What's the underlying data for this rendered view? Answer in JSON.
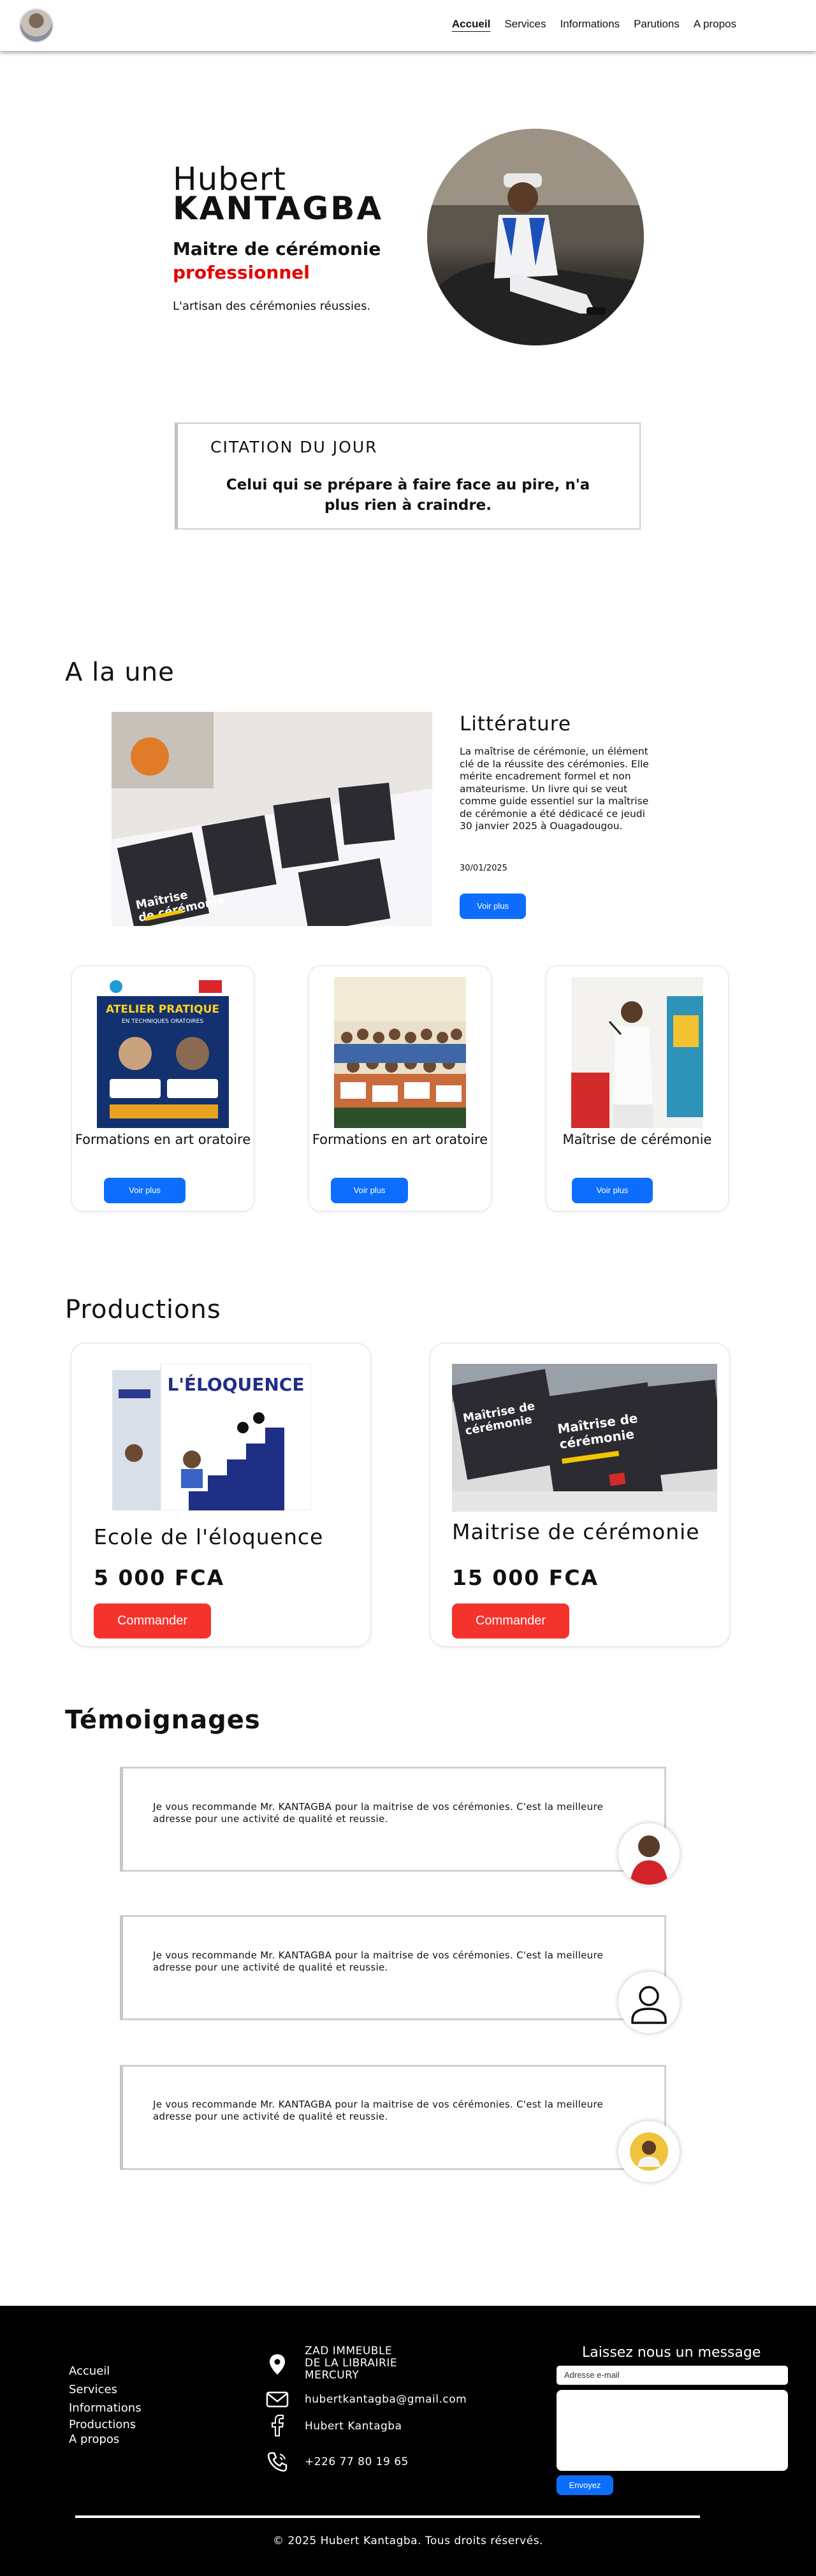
{
  "nav": {
    "items": [
      "Accueil",
      "Services",
      "Informations",
      "Parutions",
      "A propos"
    ]
  },
  "hero": {
    "name_first": "Hubert",
    "name_last": "KANTAGBA",
    "role_line1": "Maitre de cérémonie",
    "role_line2": "professionnel",
    "tagline": "L'artisan des cérémonies réussies."
  },
  "quote": {
    "title": "CITATION DU JOUR",
    "text": "Celui qui se prépare à faire face au pire, n'a plus rien à craindre."
  },
  "featured": {
    "heading": "A la une",
    "title": "Littérature",
    "body": "La maîtrise de cérémonie, un élément clé de la réussite des cérémonies. Elle mérite encadrement formel et non amateurisme. Un livre qui se veut comme guide essentiel sur la maîtrise de cérémonie a été dédicacé ce jeudi 30 janvier 2025 à Ouagadougou.",
    "date": "30/01/2025",
    "button": "Voir plus",
    "cards": [
      {
        "title": "Formations en art oratoire",
        "button": "Voir plus",
        "poster_title": "ATELIER PRATIQUE",
        "poster_sub": "EN TECHNIQUES ORATOIRES"
      },
      {
        "title": "Formations en art oratoire",
        "button": "Voir plus"
      },
      {
        "title": "Maîtrise de cérémonie",
        "button": "Voir plus"
      }
    ]
  },
  "productions": {
    "heading": "Productions",
    "items": [
      {
        "title": "Ecole de l'éloquence",
        "price": "5 000 FCA",
        "button": "Commander",
        "cover_text": "L'ÉLOQUENCE"
      },
      {
        "title": "Maitrise de cérémonie",
        "price": "15 000 FCA",
        "button": "Commander",
        "cover_text": "Maîtrise de cérémonie"
      }
    ]
  },
  "testimonials": {
    "heading": "Témoignages",
    "items": [
      {
        "text": "Je vous recommande Mr. KANTAGBA pour la maitrise de vos cérémonies. C'est la meilleure adresse pour une activité de qualité et reussie."
      },
      {
        "text": "Je vous recommande Mr. KANTAGBA pour la maitrise de vos cérémonies. C'est la meilleure adresse pour une activité de qualité et reussie."
      },
      {
        "text": "Je vous recommande Mr. KANTAGBA pour la maitrise de vos cérémonies. C'est la meilleure adresse pour une activité de qualité et reussie."
      }
    ]
  },
  "footer": {
    "links": [
      "Accueil",
      "Services",
      "Informations",
      "Productions",
      "A propos"
    ],
    "address": "ZAD IMMEUBLE DE LA LIBRAIRIE MERCURY",
    "address_lines": [
      "ZAD IMMEUBLE",
      "DE LA LIBRAIRIE",
      "MERCURY"
    ],
    "email": "hubertkantagba@gmail.com",
    "facebook": "Hubert Kantagba",
    "phone": "+226 77 80 19 65",
    "form_title": "Laissez nous un message",
    "email_placeholder": "Adresse e-mail",
    "send_button": "Envoyez",
    "copyright": "© 2025 Hubert Kantagba. Tous droits réservés."
  },
  "colors": {
    "accent_blue": "#0d6efd",
    "accent_red": "#f4342c",
    "title_red": "#e60000",
    "footer_bg": "#000000"
  }
}
